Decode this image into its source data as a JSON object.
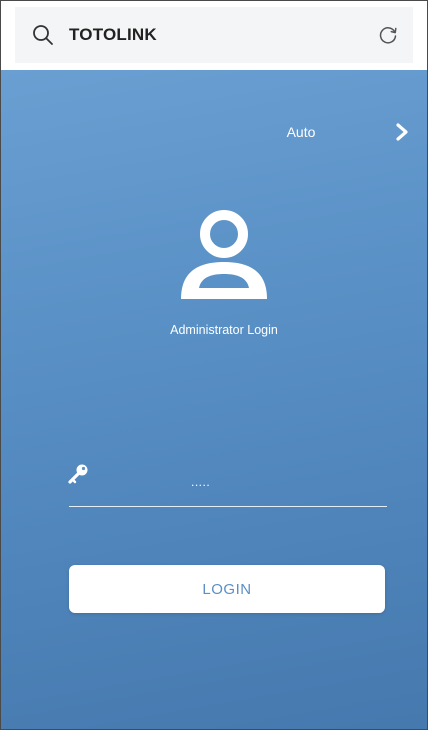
{
  "browser": {
    "address_text": "TOTOLINK",
    "icons": {
      "search": "search-icon",
      "refresh": "refresh-icon"
    }
  },
  "page": {
    "mode_label": "Auto",
    "mode_icon": "chevron-right-icon",
    "avatar_icon": "user-icon",
    "title": "Administrator Login",
    "password": {
      "icon": "key-icon",
      "value": "....."
    },
    "login_label": "LOGIN"
  },
  "colors": {
    "background_top": "#6a9fd2",
    "background_bottom": "#4679ae",
    "login_text": "#5b8fc6"
  }
}
